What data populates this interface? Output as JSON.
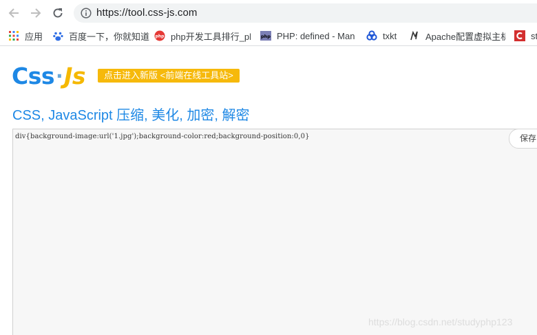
{
  "browser": {
    "url": "https://tool.css-js.com",
    "bookmarks": [
      {
        "label": "应用",
        "icon": "apps-grid-icon"
      },
      {
        "label": "百度一下，你就知道",
        "icon": "baidu-paw-icon"
      },
      {
        "label": "php开发工具排行_pl",
        "icon": "php-red-circle-icon"
      },
      {
        "label": "PHP: defined - Man",
        "icon": "php-manual-icon"
      },
      {
        "label": "txkt",
        "icon": "txkt-icon"
      },
      {
        "label": "Apache配置虚拟主机",
        "icon": "apache-feather-icon"
      },
      {
        "label": "st",
        "icon": "red-c-icon"
      }
    ]
  },
  "page": {
    "logo": {
      "part1": "Css",
      "dot": "·",
      "part2": "Js"
    },
    "promo_label": "点击进入新版 <前端在线工具站>",
    "headline": "CSS, JavaScript 压缩, 美化, 加密, 解密",
    "editor_text": "div{background-image:url('1.jpg');background-color:red;background-position:0,0}",
    "save_label": "保存",
    "watermark": "https://blog.csdn.net/studyphp123"
  },
  "colors": {
    "brand_blue": "#1e88e5",
    "brand_yellow": "#f6b90b",
    "editor_bg": "#f7f7f7"
  }
}
